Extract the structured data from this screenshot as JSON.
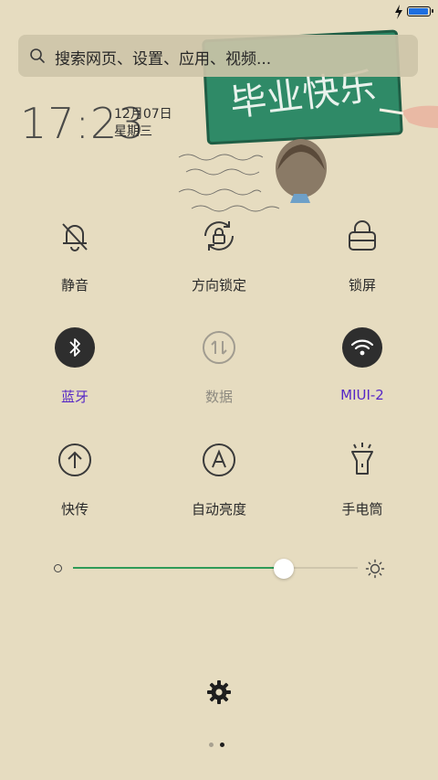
{
  "status_bar": {
    "battery_level": 0.95,
    "charging": true,
    "battery_color": "#1e6fe0"
  },
  "search": {
    "placeholder": "搜索网页、设置、应用、视频..."
  },
  "clock": {
    "time": "17:23",
    "date": "12月07日",
    "weekday": "星期三"
  },
  "wallpaper": {
    "chalkboard_text": "毕业快乐",
    "chalkboard_color": "#2f8a67"
  },
  "toggles": [
    {
      "id": "mute",
      "label": "静音",
      "icon": "bell-off-icon",
      "state": "off"
    },
    {
      "id": "rotation",
      "label": "方向锁定",
      "icon": "rotation-lock-icon",
      "state": "off"
    },
    {
      "id": "lock",
      "label": "锁屏",
      "icon": "lock-icon",
      "state": "off"
    },
    {
      "id": "bluetooth",
      "label": "蓝牙",
      "icon": "bluetooth-icon",
      "state": "on"
    },
    {
      "id": "data",
      "label": "数据",
      "icon": "data-arrows-icon",
      "state": "disabled"
    },
    {
      "id": "wifi",
      "label": "MIUI-2",
      "icon": "wifi-icon",
      "state": "on"
    },
    {
      "id": "transfer",
      "label": "快传",
      "icon": "upload-icon",
      "state": "off"
    },
    {
      "id": "auto_brightness",
      "label": "自动亮度",
      "icon": "auto-brightness-icon",
      "state": "off"
    },
    {
      "id": "flashlight",
      "label": "手电筒",
      "icon": "flashlight-icon",
      "state": "off"
    }
  ],
  "brightness": {
    "level": 0.74,
    "fill_color": "#2f9b57"
  },
  "pager": {
    "pages": 2,
    "current": 1
  },
  "colors": {
    "active_label": "#5526c6",
    "icon": "#3a3a3a",
    "active_bg": "#2e2e2e"
  }
}
